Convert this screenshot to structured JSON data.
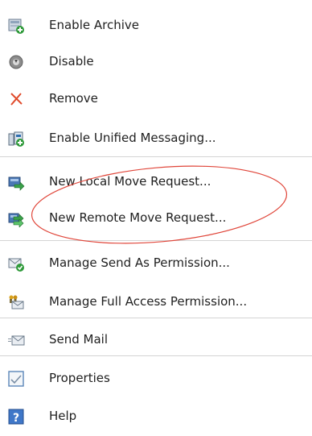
{
  "menu": {
    "items": [
      {
        "label": "Enable Archive",
        "icon": "enable-archive-icon"
      },
      {
        "label": "Disable",
        "icon": "disable-icon"
      },
      {
        "label": "Remove",
        "icon": "remove-icon"
      },
      {
        "label": "Enable Unified Messaging...",
        "icon": "unified-messaging-icon"
      },
      {
        "label": "New Local Move Request...",
        "icon": "local-move-request-icon"
      },
      {
        "label": "New Remote Move Request...",
        "icon": "remote-move-request-icon"
      },
      {
        "label": "Manage Send As Permission...",
        "icon": "send-as-permission-icon"
      },
      {
        "label": "Manage Full Access Permission...",
        "icon": "full-access-permission-icon"
      },
      {
        "label": "Send Mail",
        "icon": "send-mail-icon"
      },
      {
        "label": "Properties",
        "icon": "properties-icon"
      },
      {
        "label": "Help",
        "icon": "help-icon"
      }
    ]
  },
  "colors": {
    "annotation_ellipse": "#e0463a",
    "separator": "#d4d4d4"
  }
}
